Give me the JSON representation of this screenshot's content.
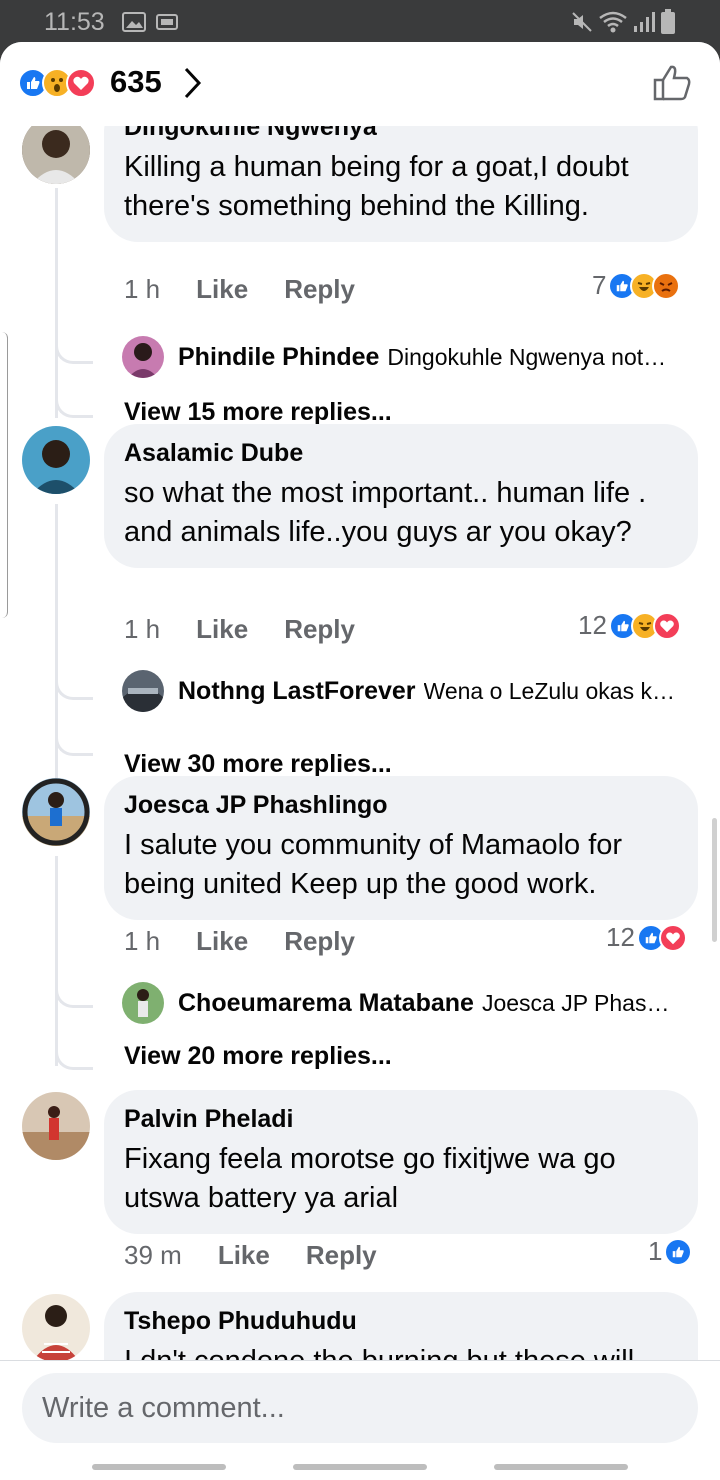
{
  "status_bar": {
    "time": "11:53"
  },
  "header": {
    "reaction_count": "635"
  },
  "comments": [
    {
      "author": "Dingokuhle Ngwenya",
      "text": "Killing a human being for a goat,I doubt there's something behind the Killing.",
      "time": "1 h",
      "like_label": "Like",
      "reply_label": "Reply",
      "reaction_count": "7",
      "reply_preview": {
        "author": "Phindile Phindee",
        "text": "Dingokuhle Ngwenya not…"
      },
      "view_more": "View 15 more replies..."
    },
    {
      "author": "Asalamic Dube",
      "text": "so what the most important.. human life . and animals life..you guys ar you okay?",
      "time": "1 h",
      "like_label": "Like",
      "reply_label": "Reply",
      "reaction_count": "12",
      "reply_preview": {
        "author": "Nothng LastForever",
        "text": "Wena o LeZulu okas k…"
      },
      "view_more": "View 30 more replies..."
    },
    {
      "author": "Joesca JP Phashlingo",
      "text": "I salute you community of Mamaolo for being united Keep up the good work.",
      "time": "1 h",
      "like_label": "Like",
      "reply_label": "Reply",
      "reaction_count": "12",
      "reply_preview": {
        "author": "Choeumarema Matabane",
        "text": "Joesca JP Phas…"
      },
      "view_more": "View 20 more replies..."
    },
    {
      "author": "Palvin Pheladi",
      "text": "Fixang feela morotse go fixitjwe wa go utswa battery ya arial",
      "time": "39 m",
      "like_label": "Like",
      "reply_label": "Reply",
      "reaction_count": "1"
    },
    {
      "author": "Tshepo Phuduhudu",
      "text": "I dn't condone the burning but these will"
    }
  ],
  "composer": {
    "placeholder": "Write a comment..."
  },
  "colors": {
    "like_blue": "#1877f2",
    "love_red": "#f33e58",
    "haha_yellow": "#f7b125",
    "angry_orange": "#e9710f",
    "bubble_gray": "#f0f2f5",
    "meta_gray": "#65676b"
  }
}
